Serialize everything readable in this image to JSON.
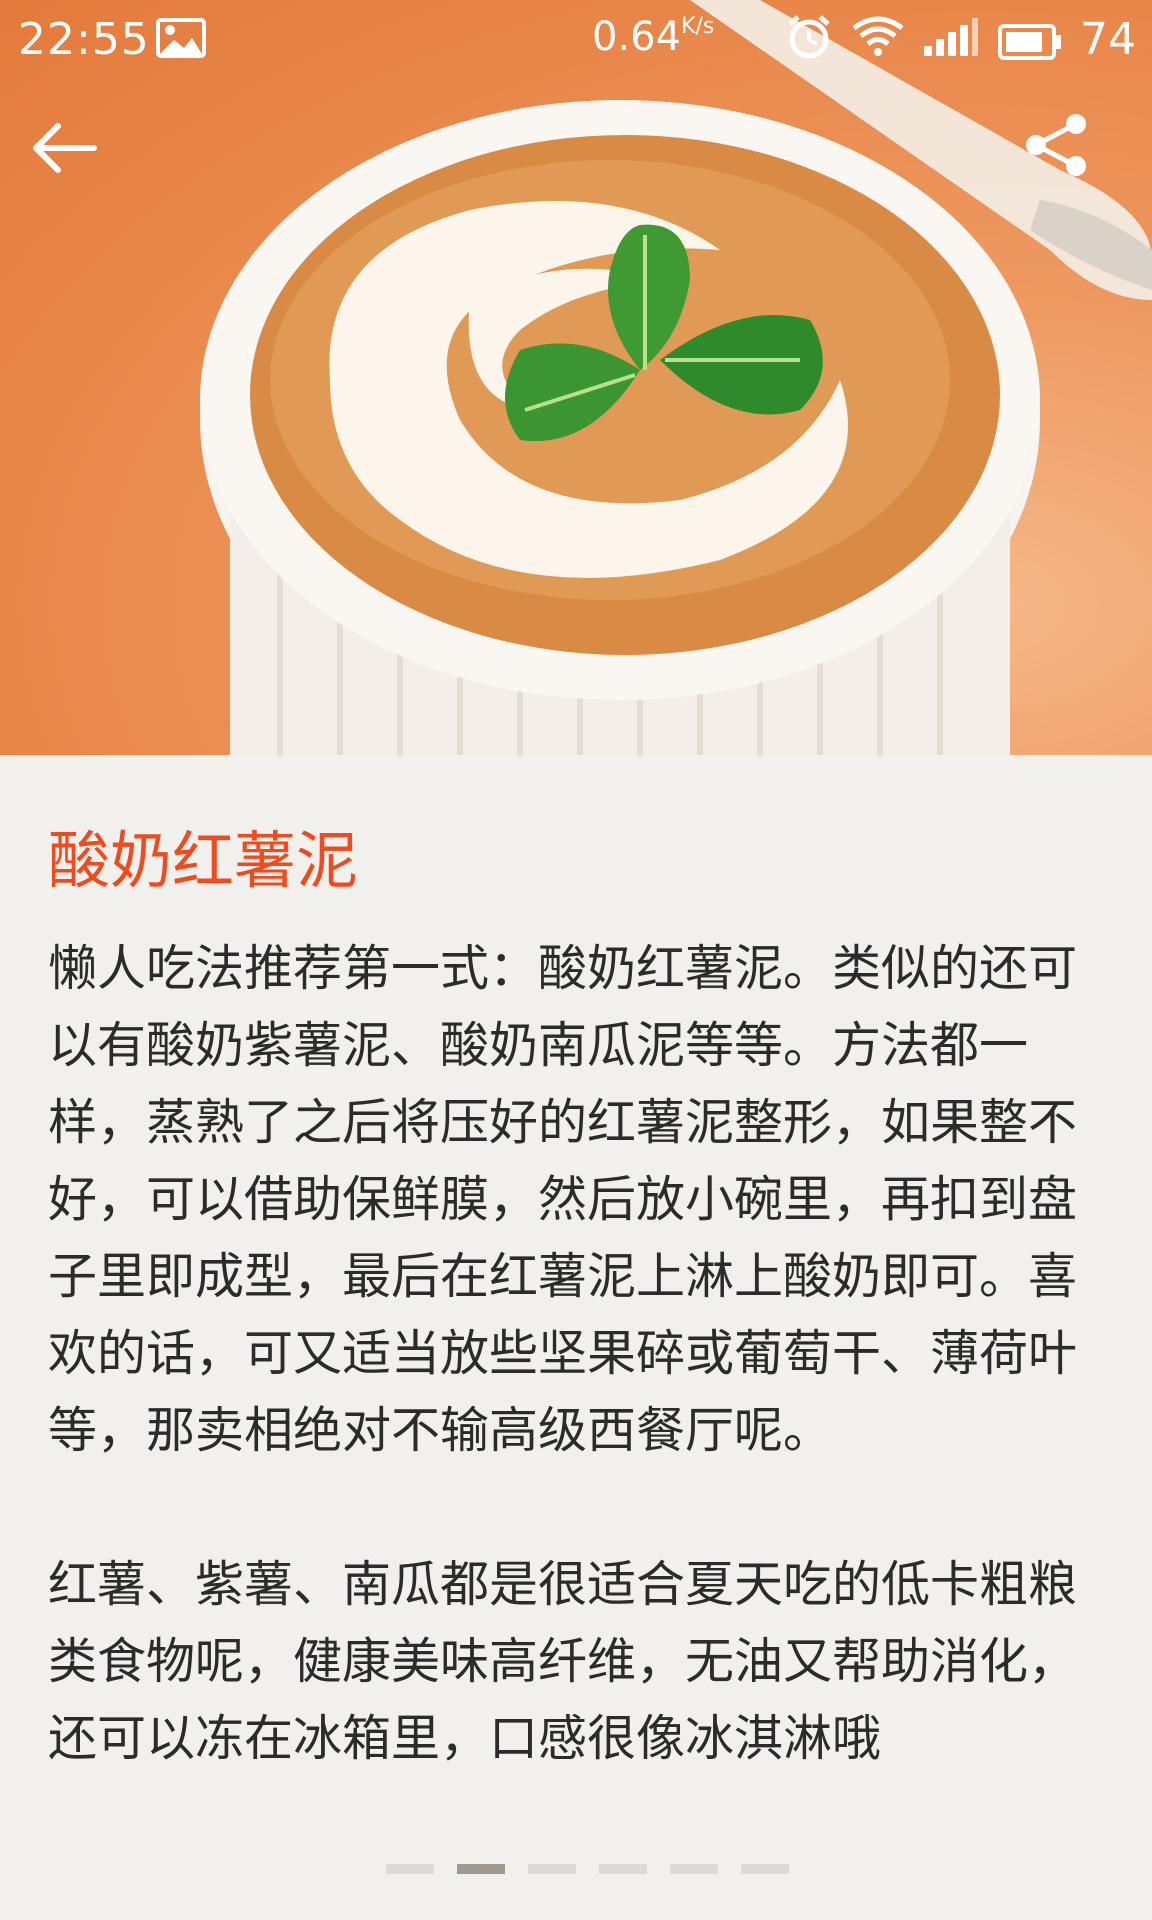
{
  "status_bar": {
    "time": "22:55",
    "speed": "0.64",
    "speed_unit": "K/s",
    "battery": "74"
  },
  "article": {
    "title": "酸奶红薯泥",
    "paragraphs": [
      "懒人吃法推荐第一式：酸奶红薯泥。类似的还可以有酸奶紫薯泥、酸奶南瓜泥等等。方法都一样，蒸熟了之后将压好的红薯泥整形，如果整不好，可以借助保鲜膜，然后放小碗里，再扣到盘子里即成型，最后在红薯泥上淋上酸奶即可。喜欢的话，可又适当放些坚果碎或葡萄干、薄荷叶等，那卖相绝对不输高级西餐厅呢。",
      "红薯、紫薯、南瓜都是很适合夏天吃的低卡粗粮类食物呢，健康美味高纤维，无油又帮助消化，还可以冻在冰箱里，口感很像冰淇淋哦"
    ]
  },
  "pager": {
    "count": 6,
    "active_index": 1
  },
  "colors": {
    "title": "#ef4b1f",
    "background": "#f1f0ec",
    "pager_active": "#a09a94",
    "pager_inactive": "#dcdad6"
  }
}
